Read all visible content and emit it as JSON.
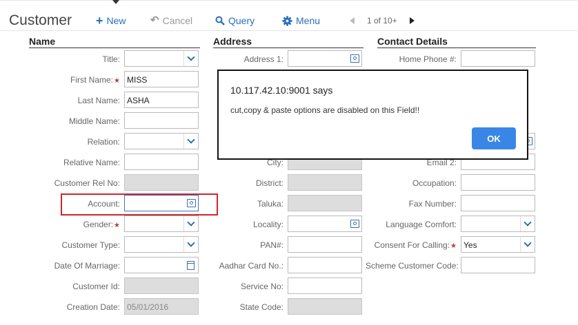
{
  "header": {
    "title": "Customer",
    "new_label": "New",
    "cancel_label": "Cancel",
    "query_label": "Query",
    "menu_label": "Menu",
    "pager": "1 of 10+"
  },
  "sections": {
    "name": "Name",
    "address": "Address",
    "contact": "Contact Details"
  },
  "name_fields": {
    "title": {
      "label": "Title:",
      "value": ""
    },
    "first_name": {
      "label": "First Name:",
      "value": "MISS"
    },
    "last_name": {
      "label": "Last Name:",
      "value": "ASHA"
    },
    "middle_name": {
      "label": "Middle Name:",
      "value": ""
    },
    "relation": {
      "label": "Relation:",
      "value": ""
    },
    "relative_name": {
      "label": "Relative Name:",
      "value": ""
    },
    "customer_rel_no": {
      "label": "Customer Rel No:",
      "value": ""
    },
    "account": {
      "label": "Account:",
      "value": ""
    },
    "gender": {
      "label": "Gender:",
      "value": ""
    },
    "customer_type": {
      "label": "Customer Type:",
      "value": ""
    },
    "date_of_marriage": {
      "label": "Date Of Marriage:",
      "value": ""
    },
    "customer_id": {
      "label": "Customer Id:",
      "value": ""
    },
    "creation_date": {
      "label": "Creation Date:",
      "value": "05/01/2016"
    }
  },
  "address_fields": {
    "address1": {
      "label": "Address 1:",
      "value": ""
    },
    "city": {
      "label": "City:",
      "value": ""
    },
    "district": {
      "label": "District:",
      "value": ""
    },
    "taluka": {
      "label": "Taluka:",
      "value": ""
    },
    "locality": {
      "label": "Locality:",
      "value": ""
    },
    "pan": {
      "label": "PAN#:",
      "value": ""
    },
    "aadhar": {
      "label": "Aadhar Card No.:",
      "value": ""
    },
    "service_no": {
      "label": "Service No:",
      "value": ""
    },
    "state_code": {
      "label": "State Code:",
      "value": ""
    }
  },
  "contact_fields": {
    "home_phone": {
      "label": "Home Phone #:",
      "value": ""
    },
    "email2": {
      "label": "Email 2:",
      "value": ""
    },
    "occupation": {
      "label": "Occupation:",
      "value": ""
    },
    "fax": {
      "label": "Fax Number:",
      "value": ""
    },
    "language": {
      "label": "Language Comfort:",
      "value": ""
    },
    "consent": {
      "label": "Consent For Calling:",
      "value": "Yes"
    },
    "scheme_code": {
      "label": "Scheme Customer Code:",
      "value": ""
    }
  },
  "dialog": {
    "title": "10.117.42.10:9001 says",
    "message": "cut,copy & paste options are disabled on this Field!!",
    "ok_label": "OK"
  },
  "colors": {
    "accent": "#2a6ebb",
    "ok_button": "#3a86e6",
    "highlight": "#d0232b",
    "required": "#c0392b"
  }
}
